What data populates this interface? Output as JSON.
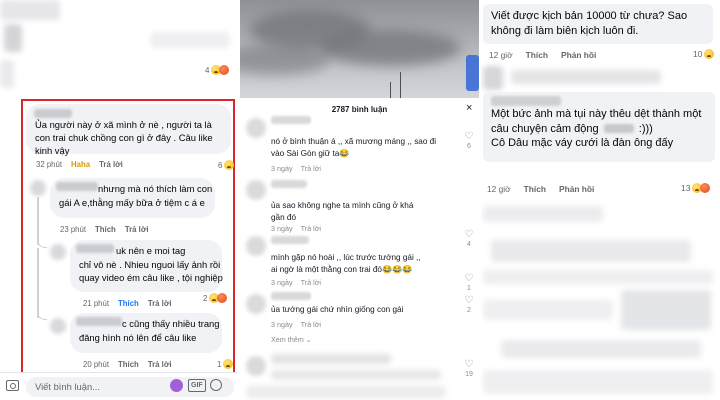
{
  "panel1": {
    "top_reaction_count": "4",
    "comments": [
      {
        "text_a": "Ủa người này ở xã mình ở nè , người ta là",
        "text_b": "con trai chuk chồng con gì ở đây . Câu like",
        "text_c": "kinh vậy",
        "time": "32 phút",
        "reaction_label": "Haha",
        "reply": "Trả lời",
        "count": "6"
      },
      {
        "text_a": "nhưng mà nó thích làm con",
        "text_b": "gái A e,thằng mấy bữa ở tiệm c á e",
        "time": "23 phút",
        "like": "Thích",
        "reply": "Trả lời"
      },
      {
        "text_a": "uk nên e moi tag",
        "text_b": "chỉ vô nè . Nhieu nguoi lấy ảnh rồi",
        "text_c": "quay video ém câu like , tội nghiệp",
        "time": "21 phút",
        "like": "Thích",
        "reply": "Trả lời",
        "count": "2"
      },
      {
        "text_a": "c cũng thấy nhiều trang",
        "text_b": "đăng hình nó lên để câu like",
        "time": "20 phút",
        "like": "Thích",
        "reply": "Trả lời",
        "count": "1"
      }
    ],
    "composer": {
      "placeholder": "Viết bình luận...",
      "gif_label": "GIF"
    }
  },
  "panel2": {
    "header": "2787 bình luận",
    "close": "×",
    "comments": [
      {
        "text_a": "nó ở bình thuận á ,, xã mương máng ,, sao đi",
        "text_b": "vào Sài Gòn giữ ta😂",
        "time": "3 ngày",
        "reply": "Trả lời",
        "likes": "6"
      },
      {
        "text_a": "ủa sao không nghe ta mình cũng ở khá",
        "text_b": "gần đó",
        "time": "3 ngày",
        "reply": "Trả lời",
        "likes": "4"
      },
      {
        "text_a": "mình gặp nó hoài ,, lúc trước tướng gái ,,",
        "text_b": "ai ngờ là một thằng con trai đó😂😂😂",
        "time": "3 ngày",
        "reply": "Trả lời",
        "likes": "1"
      },
      {
        "text_a": "ủa tướng gái chứ nhìn giống con gái",
        "time": "3 ngày",
        "reply": "Trả lời",
        "likes": "2"
      }
    ],
    "view_more": "Xem thêm ⌄",
    "last_likes": "19"
  },
  "panel3": {
    "comment1": {
      "line1": "Viết được kịch bản 10000 từ chưa? Sao",
      "line2": "không đi làm biên kịch luôn đi.",
      "time": "12 giờ",
      "like": "Thích",
      "reply": "Phản hồi",
      "count": "10"
    },
    "comment2": {
      "line1": "Một bức ảnh mà tụi này thêu dệt thành một",
      "line2a": "câu chuyện cảm động",
      "line2b": ":)))",
      "line3": "Cô Dâu mặc váy cưới là đàn ông đấy",
      "time": "12 giờ",
      "like": "Thích",
      "reply": "Phản hồi",
      "count": "13"
    }
  },
  "colors": {
    "highlight_border": "#d9262b",
    "like_blue": "#1877f2",
    "haha_gold": "#d99a00"
  }
}
